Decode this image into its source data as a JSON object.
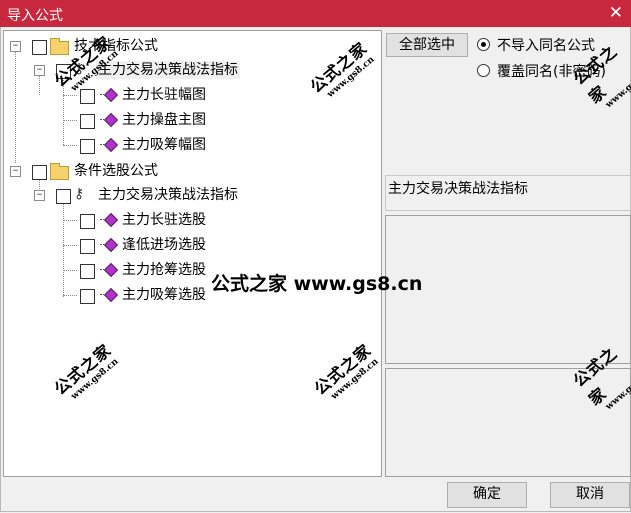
{
  "window": {
    "title": "导入公式",
    "close_glyph": "✕"
  },
  "tree": {
    "groups": [
      {
        "label": "技术指标公式",
        "expander": "−",
        "child": {
          "label": "主力交易决策战法指标",
          "expander": "−",
          "items": [
            "主力长驻幅图",
            "主力操盘主图",
            "主力吸筹幅图"
          ]
        }
      },
      {
        "label": "条件选股公式",
        "expander": "−",
        "child": {
          "label": "主力交易决策战法指标",
          "expander": "−",
          "items": [
            "主力长驻选股",
            "逢低进场选股",
            "主力抢筹选股",
            "主力吸筹选股"
          ]
        }
      }
    ]
  },
  "right": {
    "select_all": "全部选中",
    "radio_skip": "不导入同名公式",
    "radio_overwrite": "覆盖同名(非密码)",
    "description": "主力交易决策战法指标"
  },
  "buttons": {
    "ok": "确定",
    "cancel": "取消"
  },
  "watermark": {
    "mark": "公式之家",
    "url": "www.gs8.cn",
    "center": "公式之家 www.gs8.cn"
  },
  "colors": {
    "titlebar": "#c8283e",
    "gem": "#b033c8",
    "folder": "#f6d26e"
  }
}
